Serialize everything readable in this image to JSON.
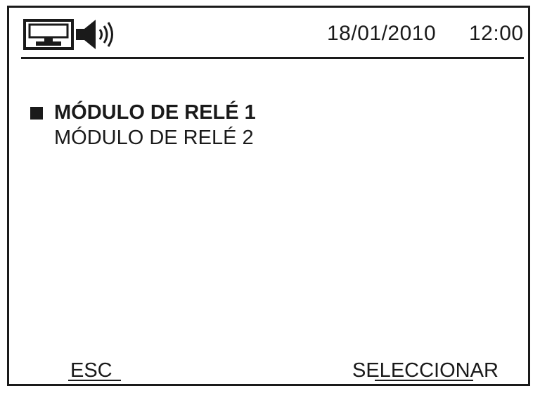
{
  "header": {
    "network_icon": "network-icon",
    "speaker_icon": "speaker-icon",
    "date": "18/01/2010",
    "time": "12:00"
  },
  "menu": {
    "items": [
      {
        "label": "MÓDULO DE RELÉ 1",
        "selected": true
      },
      {
        "label": "MÓDULO DE RELÉ 2",
        "selected": false
      }
    ]
  },
  "softkeys": {
    "left_label": "ESC",
    "right_label": "SELECCIONAR"
  },
  "colors": {
    "foreground": "#1a1a1a",
    "background": "#ffffff"
  }
}
